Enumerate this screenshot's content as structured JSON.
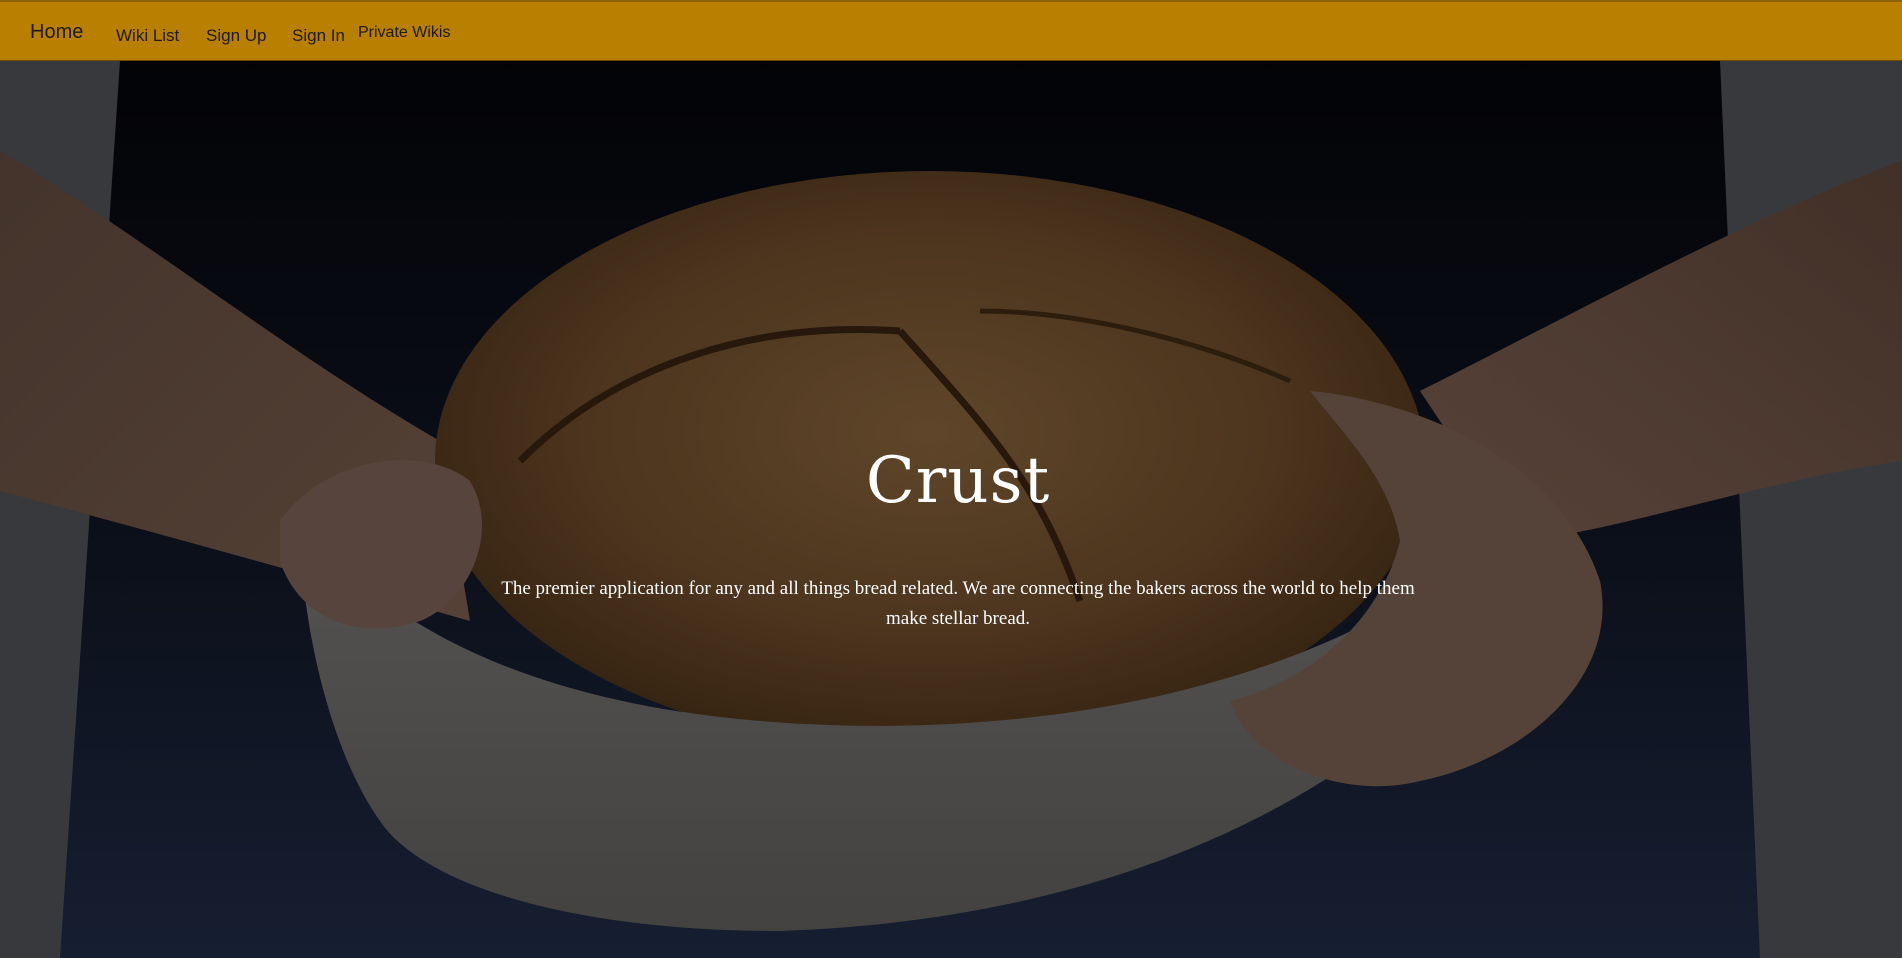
{
  "nav": {
    "brand": "Home",
    "links": [
      "Wiki List",
      "Sign Up",
      "Sign In",
      "Private Wikis"
    ]
  },
  "hero": {
    "title": "Crust",
    "subtitle": "The premier application for any and all things bread related. We are connecting the bakers across the world to help them make stellar bread."
  },
  "colors": {
    "navbar": "#b87f00",
    "nav_text": "#1f1a10",
    "hero_text": "#ffffff"
  },
  "icons": {
    "hero_image": "bread-loaf-in-hands-photo"
  }
}
